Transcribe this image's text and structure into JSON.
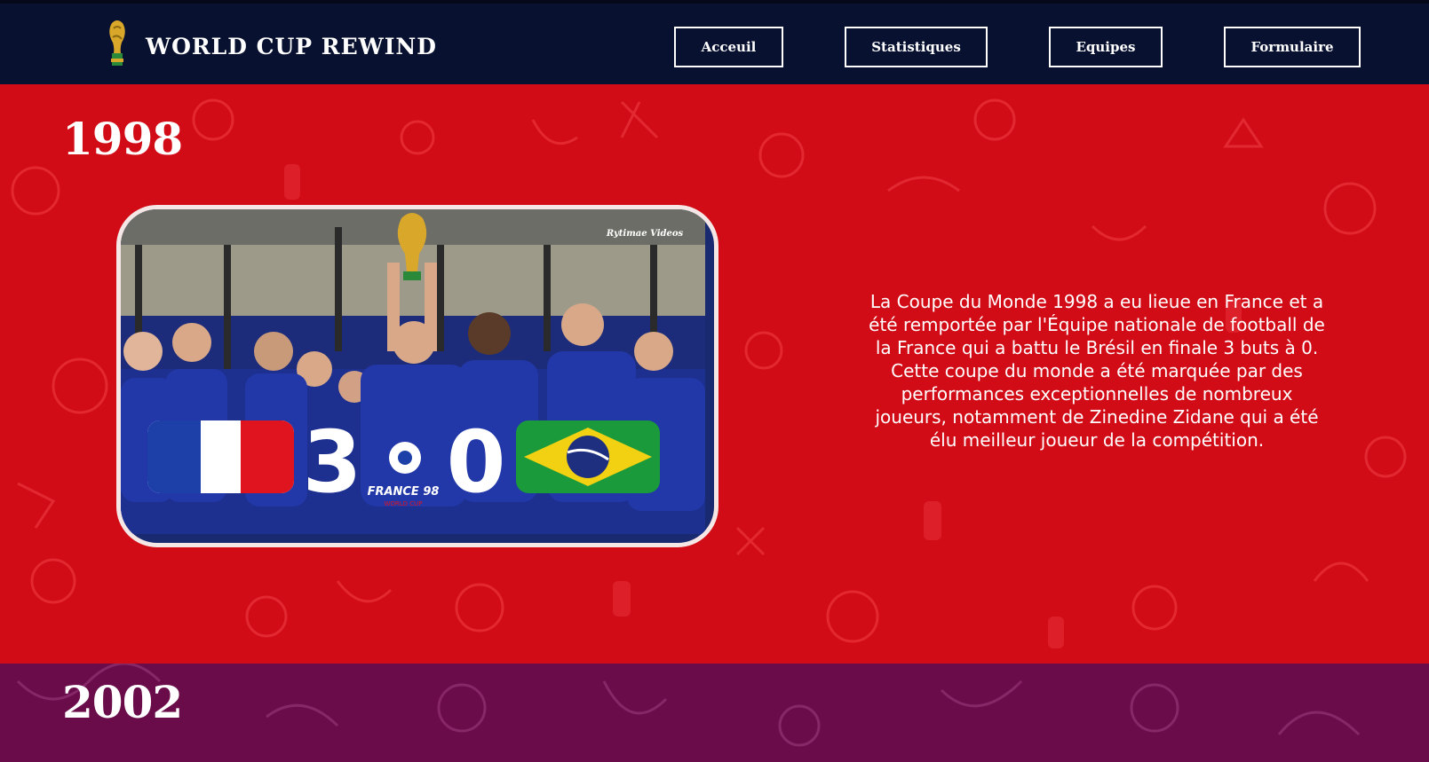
{
  "header": {
    "brand_title": "WORLD CUP REWIND",
    "nav": [
      "Acceuil",
      "Statistiques",
      "Equipes",
      "Formulaire"
    ]
  },
  "sections": [
    {
      "year": "1998",
      "background_color": "#d20c16",
      "photo": {
        "score_home": "3",
        "score_away": "0",
        "logo_text": "FRANCE 98",
        "logo_subtext": "WORLD CUP",
        "watermark": "Rytimae Videos"
      },
      "description": "La Coupe du Monde 1998 a eu lieue en France et a été remportée par l'Équipe nationale de football de la France qui a battu le Brésil en finale 3 buts à 0. Cette coupe du monde a été marquée par des performances exceptionnelles de nombreux joueurs, notamment de Zinedine Zidane qui a été élu meilleur joueur de la compétition."
    },
    {
      "year": "2002",
      "background_color": "#6a0b4a"
    }
  ],
  "colors": {
    "header_bg": "#081230",
    "accent_red": "#d20c16",
    "accent_purple": "#6a0b4a"
  }
}
